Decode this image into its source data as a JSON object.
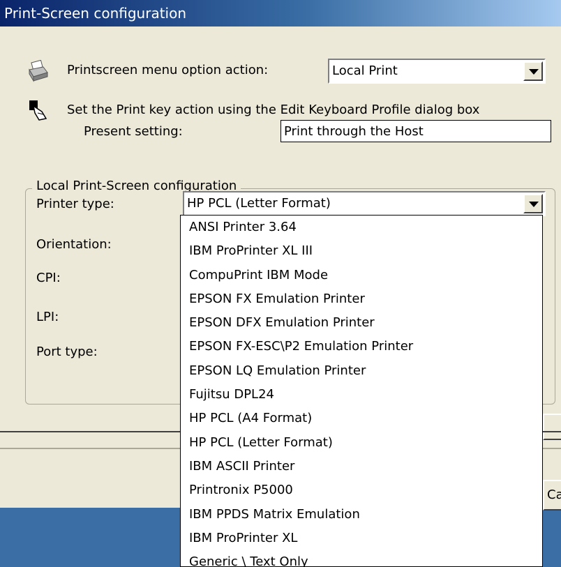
{
  "window": {
    "title": "Print-Screen configuration"
  },
  "printscreen": {
    "label": "Printscreen menu option action:",
    "selected": "Local Print"
  },
  "print_key": {
    "info": "Set the Print key action using the Edit Keyboard Profile dialog box",
    "present_label": "Present setting:",
    "present_value": "Print through the Host"
  },
  "local_group": {
    "title": "Local Print-Screen configuration",
    "printer_type_label": "Printer type:",
    "printer_type_selected": "HP PCL (Letter Format)",
    "orientation_label": "Orientation:",
    "cpi_label": "CPI:",
    "lpi_label": "LPI:",
    "port_type_label": "Port type:"
  },
  "buttons": {
    "cancel_partial": "Can"
  },
  "dropdown": {
    "options": [
      "ANSI Printer 3.64",
      "IBM ProPrinter XL III",
      "CompuPrint IBM Mode",
      "EPSON FX Emulation Printer",
      "EPSON DFX Emulation Printer",
      "EPSON FX-ESC\\P2 Emulation Printer",
      "EPSON LQ Emulation Printer",
      "Fujitsu DPL24",
      "HP PCL (A4 Format)",
      "HP PCL (Letter Format)",
      "IBM ASCII Printer",
      "Printronix P5000",
      "IBM PPDS Matrix Emulation",
      "IBM ProPrinter XL",
      "Generic \\ Text Only"
    ]
  }
}
